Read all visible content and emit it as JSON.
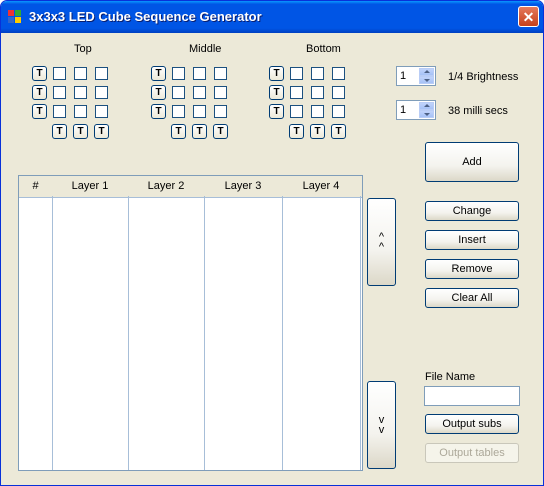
{
  "window": {
    "title": "3x3x3 LED Cube Sequence Generator",
    "close_glyph": "✕"
  },
  "layers": {
    "top_label": "Top",
    "middle_label": "Middle",
    "bottom_label": "Bottom",
    "toggle_label": "T"
  },
  "brightness": {
    "value": "1",
    "label": "1/4 Brightness"
  },
  "delay": {
    "value": "1",
    "label": "38 milli secs"
  },
  "buttons": {
    "add": "Add",
    "change": "Change",
    "insert": "Insert",
    "remove": "Remove",
    "clear_all": "Clear All",
    "move_up": "^\n^",
    "move_down": "v\nv",
    "output_subs": "Output subs",
    "output_tables": "Output tables"
  },
  "list": {
    "columns": [
      "#",
      "Layer 1",
      "Layer 2",
      "Layer 3",
      "Layer 4"
    ],
    "rows": []
  },
  "file": {
    "label": "File Name",
    "value": ""
  },
  "colors": {
    "title_bar": "#0055e5",
    "close": "#c6401b",
    "face": "#ece9d8",
    "border": "#003c74"
  }
}
